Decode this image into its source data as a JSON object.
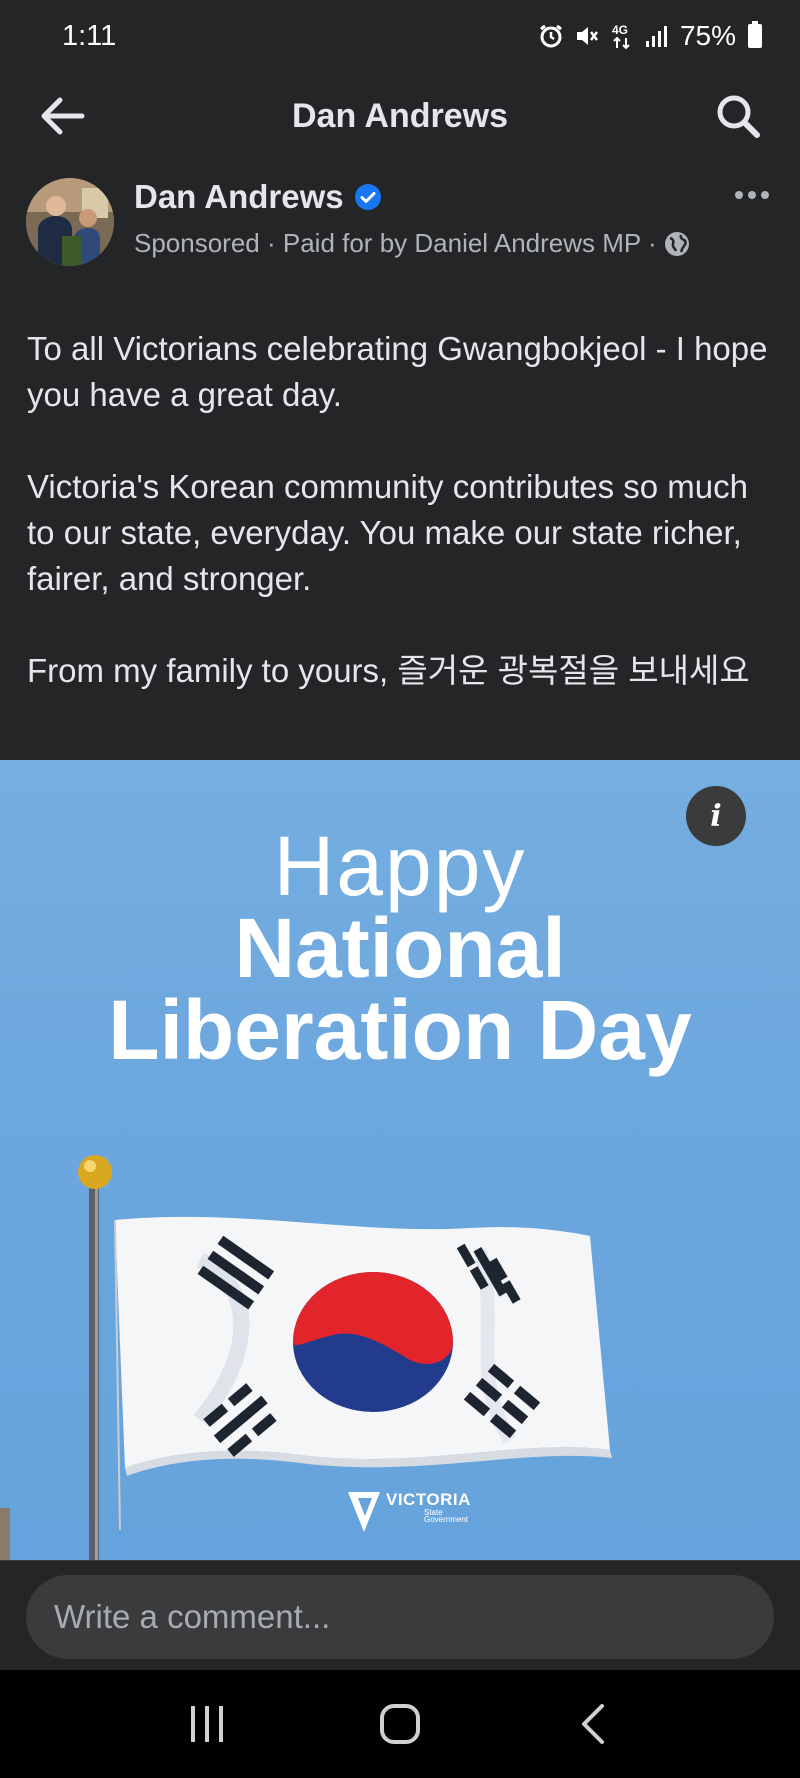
{
  "status_bar": {
    "time": "1:11",
    "network": "4G",
    "battery": "75%",
    "icons": [
      "alarm-icon",
      "mute-icon",
      "network-4g-icon",
      "signal-icon",
      "battery-icon"
    ]
  },
  "header": {
    "title": "Dan Andrews",
    "back_icon": "back-arrow-icon",
    "search_icon": "search-icon"
  },
  "post": {
    "author": "Dan Andrews",
    "verified": true,
    "meta": "Sponsored · Paid for by Daniel Andrews MP ·",
    "paragraphs": [
      "To all Victorians celebrating Gwangbokjeol - I hope you have a great day.",
      "Victoria's Korean community contributes so much to our state, everyday. You make our state richer, fairer, and stronger.",
      "From my family to yours, 즐거운 광복절을 보내세요"
    ],
    "image": {
      "line1": "Happy",
      "line2": "National",
      "line3": "Liberation Day",
      "logo_word": "VICTORIA",
      "logo_sub1": "State",
      "logo_sub2": "Government",
      "info_label": "i"
    }
  },
  "comment": {
    "placeholder": "Write a comment..."
  },
  "colors": {
    "background": "#242526",
    "text": "#e4e6eb",
    "secondary_text": "#b0b3b8",
    "verified_blue": "#1877f2",
    "sky": "#6ca7de",
    "flag_red": "#e2252b",
    "flag_blue": "#233b8c"
  }
}
